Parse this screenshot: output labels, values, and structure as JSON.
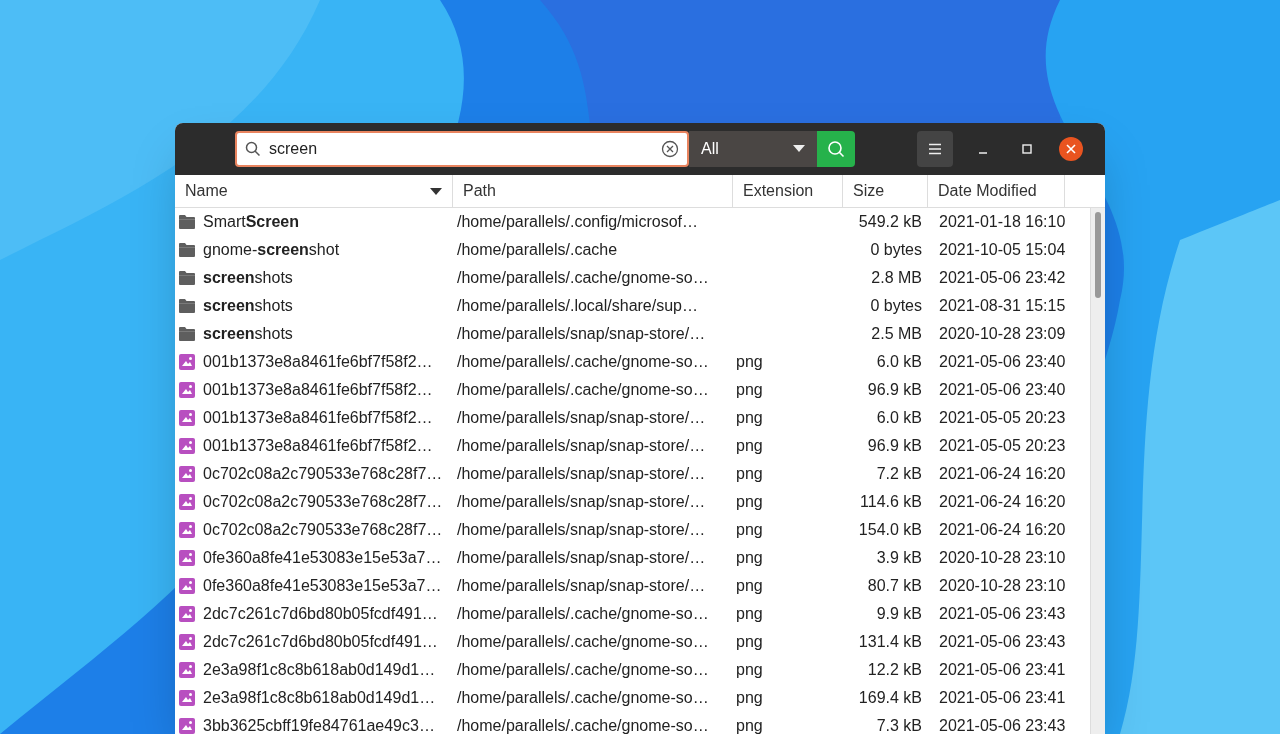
{
  "search": {
    "value": "screen"
  },
  "filter": {
    "value": "All"
  },
  "table": {
    "columns": [
      {
        "label": "Name",
        "sorted": true
      },
      {
        "label": "Path",
        "sorted": false
      },
      {
        "label": "Extension",
        "sorted": false
      },
      {
        "label": "Size",
        "sorted": false
      },
      {
        "label": "Date Modified",
        "sorted": false
      }
    ],
    "rows": [
      {
        "kind": "folder",
        "name": "Smart**Screen**",
        "path": "/home/parallels/.config/microsof…",
        "size": "549.2 kB",
        "date": "2021-01-18 16:10"
      },
      {
        "kind": "folder",
        "name": "gnome-**screen**shot",
        "path": "/home/parallels/.cache",
        "size": "0 bytes",
        "date": "2021-10-05 15:04"
      },
      {
        "kind": "folder",
        "name": "**screen**shots",
        "path": "/home/parallels/.cache/gnome-so…",
        "size": "2.8 MB",
        "date": "2021-05-06 23:42"
      },
      {
        "kind": "folder",
        "name": "**screen**shots",
        "path": "/home/parallels/.local/share/sup…",
        "size": "0 bytes",
        "date": "2021-08-31 15:15"
      },
      {
        "kind": "folder",
        "name": "**screen**shots",
        "path": "/home/parallels/snap/snap-store/…",
        "size": "2.5 MB",
        "date": "2020-10-28 23:09"
      },
      {
        "kind": "image",
        "name": "001b1373e8a8461fe6bf7f58f2…",
        "path": "/home/parallels/.cache/gnome-so…",
        "extension": "png",
        "size": "6.0 kB",
        "date": "2021-05-06 23:40"
      },
      {
        "kind": "image",
        "name": "001b1373e8a8461fe6bf7f58f2…",
        "path": "/home/parallels/.cache/gnome-so…",
        "extension": "png",
        "size": "96.9 kB",
        "date": "2021-05-06 23:40"
      },
      {
        "kind": "image",
        "name": "001b1373e8a8461fe6bf7f58f2…",
        "path": "/home/parallels/snap/snap-store/…",
        "extension": "png",
        "size": "6.0 kB",
        "date": "2021-05-05 20:23"
      },
      {
        "kind": "image",
        "name": "001b1373e8a8461fe6bf7f58f2…",
        "path": "/home/parallels/snap/snap-store/…",
        "extension": "png",
        "size": "96.9 kB",
        "date": "2021-05-05 20:23"
      },
      {
        "kind": "image",
        "name": "0c702c08a2c790533e768c28f7…",
        "path": "/home/parallels/snap/snap-store/…",
        "extension": "png",
        "size": "7.2 kB",
        "date": "2021-06-24 16:20"
      },
      {
        "kind": "image",
        "name": "0c702c08a2c790533e768c28f7…",
        "path": "/home/parallels/snap/snap-store/…",
        "extension": "png",
        "size": "114.6 kB",
        "date": "2021-06-24 16:20"
      },
      {
        "kind": "image",
        "name": "0c702c08a2c790533e768c28f7…",
        "path": "/home/parallels/snap/snap-store/…",
        "extension": "png",
        "size": "154.0 kB",
        "date": "2021-06-24 16:20"
      },
      {
        "kind": "image",
        "name": "0fe360a8fe41e53083e15e53a7…",
        "path": "/home/parallels/snap/snap-store/…",
        "extension": "png",
        "size": "3.9 kB",
        "date": "2020-10-28 23:10"
      },
      {
        "kind": "image",
        "name": "0fe360a8fe41e53083e15e53a7…",
        "path": "/home/parallels/snap/snap-store/…",
        "extension": "png",
        "size": "80.7 kB",
        "date": "2020-10-28 23:10"
      },
      {
        "kind": "image",
        "name": "2dc7c261c7d6bd80b05fcdf491…",
        "path": "/home/parallels/.cache/gnome-so…",
        "extension": "png",
        "size": "9.9 kB",
        "date": "2021-05-06 23:43"
      },
      {
        "kind": "image",
        "name": "2dc7c261c7d6bd80b05fcdf491…",
        "path": "/home/parallels/.cache/gnome-so…",
        "extension": "png",
        "size": "131.4 kB",
        "date": "2021-05-06 23:43"
      },
      {
        "kind": "image",
        "name": "2e3a98f1c8c8b618ab0d149d1…",
        "path": "/home/parallels/.cache/gnome-so…",
        "extension": "png",
        "size": "12.2 kB",
        "date": "2021-05-06 23:41"
      },
      {
        "kind": "image",
        "name": "2e3a98f1c8c8b618ab0d149d1…",
        "path": "/home/parallels/.cache/gnome-so…",
        "extension": "png",
        "size": "169.4 kB",
        "date": "2021-05-06 23:41"
      },
      {
        "kind": "image",
        "name": "3bb3625cbff19fe84761ae49c3…",
        "path": "/home/parallels/.cache/gnome-so…",
        "extension": "png",
        "size": "7.3 kB",
        "date": "2021-05-06 23:43"
      }
    ]
  }
}
